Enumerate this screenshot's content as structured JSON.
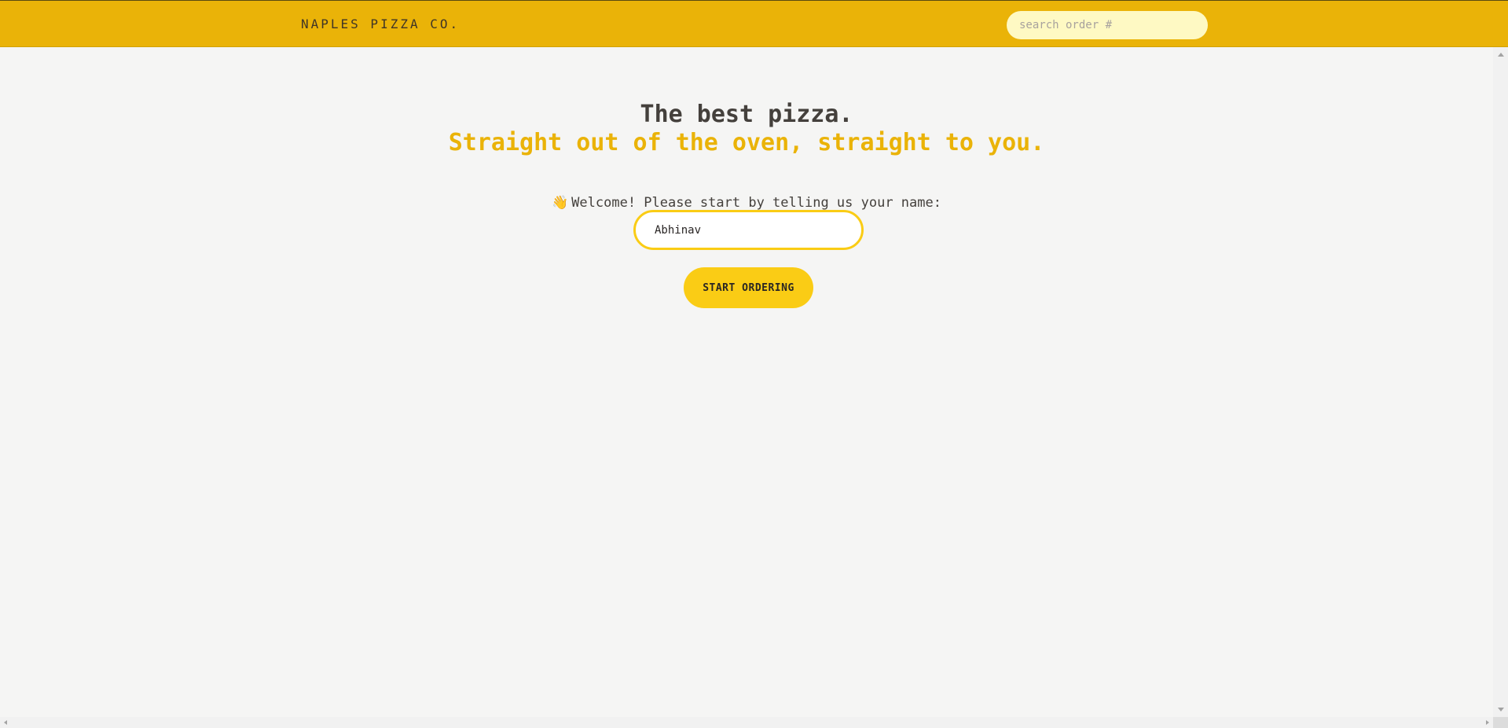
{
  "header": {
    "brand": "NAPLES PIZZA CO.",
    "search_placeholder": "search order #",
    "search_value": ""
  },
  "hero": {
    "title": "The best pizza.",
    "subtitle": "Straight out of the oven, straight to you."
  },
  "form": {
    "wave_emoji": "👋",
    "prompt": "Welcome! Please start by telling us your name:",
    "name_value": "Abhinav",
    "submit_label": "START ORDERING"
  },
  "colors": {
    "header_bg": "#eab308",
    "accent": "#eab308",
    "button_bg": "#facc15",
    "search_bg": "#fef9c3",
    "page_bg": "#f5f5f4"
  },
  "icons": {
    "wave": "waving-hand-icon"
  }
}
